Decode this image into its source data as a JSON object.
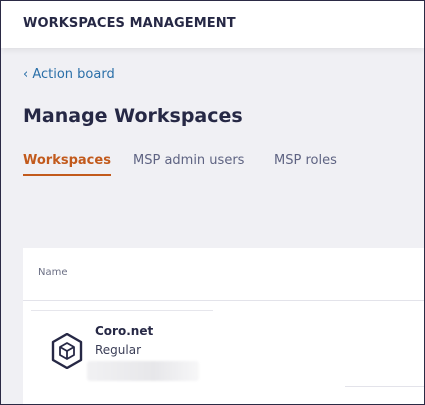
{
  "header": {
    "title": "WORKSPACES MANAGEMENT"
  },
  "nav": {
    "back_link": "‹ Action board"
  },
  "page": {
    "title": "Manage Workspaces"
  },
  "tabs": [
    {
      "label": "Workspaces",
      "active": true
    },
    {
      "label": "MSP admin users",
      "active": false
    },
    {
      "label": "MSP roles",
      "active": false
    }
  ],
  "table": {
    "columns": [
      "Name"
    ],
    "rows": [
      {
        "icon": "workspace-cube-icon",
        "name": "Coro.net",
        "type": "Regular"
      }
    ]
  },
  "colors": {
    "accent": "#c25a1c",
    "link": "#2a6fa8",
    "text_dark": "#262845"
  }
}
